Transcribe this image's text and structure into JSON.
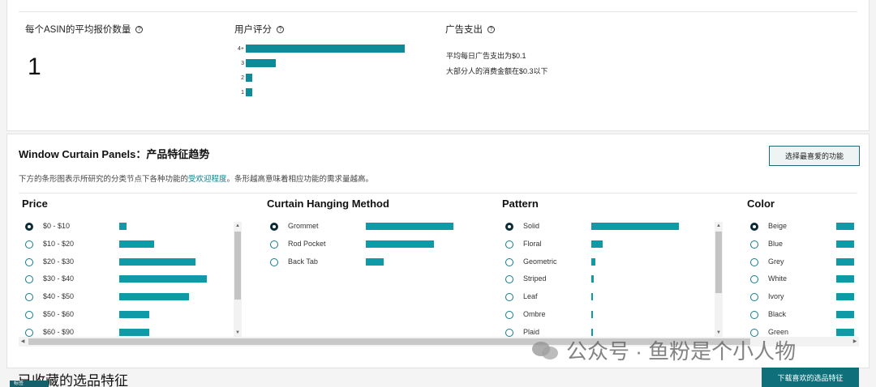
{
  "stats": {
    "avg_reviews": {
      "title": "每个ASIN的平均报价数量",
      "value": "1"
    },
    "rating": {
      "title": "用户评分",
      "rows": [
        {
          "label": "4+",
          "level": 1.0
        },
        {
          "label": "3",
          "level": 0.19
        },
        {
          "label": "2",
          "level": 0.04
        },
        {
          "label": "1",
          "level": 0.04
        }
      ]
    },
    "ad_spend": {
      "title": "广告支出",
      "line1": "平均每日广告支出为$0.1",
      "line2": "大部分人的消费金额在$0.3以下"
    }
  },
  "feature": {
    "title": "Window Curtain Panels：产品特征趋势",
    "favorite_button": "选择最喜爱的功能",
    "desc_before": "下方的条形图表示所研究的分类节点下各种功能的",
    "desc_link": "受欢迎程度",
    "desc_after": "。条形越高意味着相应功能的需求量越高。",
    "panels": [
      {
        "title": "Price",
        "options": [
          {
            "label": "$0 - $10",
            "selected": true,
            "level": 0.08
          },
          {
            "label": "$10 - $20",
            "selected": false,
            "level": 0.4
          },
          {
            "label": "$20 - $30",
            "selected": false,
            "level": 0.87
          },
          {
            "label": "$30 - $40",
            "selected": false,
            "level": 1.0
          },
          {
            "label": "$40 - $50",
            "selected": false,
            "level": 0.8
          },
          {
            "label": "$50 - $60",
            "selected": false,
            "level": 0.34
          },
          {
            "label": "$60 - $90",
            "selected": false,
            "level": 0.34
          }
        ]
      },
      {
        "title": "Curtain Hanging Method",
        "options": [
          {
            "label": "Grommet",
            "selected": true,
            "level": 1.0
          },
          {
            "label": "Rod Pocket",
            "selected": false,
            "level": 0.78
          },
          {
            "label": "Back Tab",
            "selected": false,
            "level": 0.2
          }
        ]
      },
      {
        "title": "Pattern",
        "options": [
          {
            "label": "Solid",
            "selected": true,
            "level": 1.0
          },
          {
            "label": "Floral",
            "selected": false,
            "level": 0.13
          },
          {
            "label": "Geometric",
            "selected": false,
            "level": 0.05
          },
          {
            "label": "Striped",
            "selected": false,
            "level": 0.03
          },
          {
            "label": "Leaf",
            "selected": false,
            "level": 0.02
          },
          {
            "label": "Ombre",
            "selected": false,
            "level": 0.02
          },
          {
            "label": "Plaid",
            "selected": false,
            "level": 0.02
          }
        ]
      },
      {
        "title": "Color",
        "options": [
          {
            "label": "Beige",
            "selected": true,
            "level": 1.0
          },
          {
            "label": "Blue",
            "selected": false,
            "level": 1.0
          },
          {
            "label": "Grey",
            "selected": false,
            "level": 1.0
          },
          {
            "label": "White",
            "selected": false,
            "level": 1.0
          },
          {
            "label": "Ivory",
            "selected": false,
            "level": 1.0
          },
          {
            "label": "Black",
            "selected": false,
            "level": 1.0
          },
          {
            "label": "Green",
            "selected": false,
            "level": 1.0
          }
        ]
      }
    ]
  },
  "saved": {
    "title": "已收藏的选品特征",
    "download_button": "下载喜欢的选品特征",
    "tag": "标签"
  },
  "watermark": {
    "text": "公众号 · 鱼粉是个小人物"
  },
  "colors": {
    "accent": "#0f9aa8",
    "dark_teal": "#0f6f7a"
  }
}
